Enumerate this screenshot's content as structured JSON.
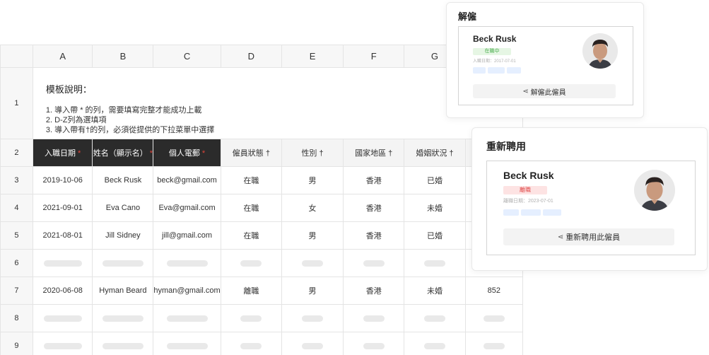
{
  "sheet": {
    "columns": [
      "A",
      "B",
      "C",
      "D",
      "E",
      "F",
      "G"
    ],
    "rows": [
      "1",
      "2",
      "3",
      "4",
      "5",
      "6",
      "7",
      "8",
      "9"
    ],
    "note": {
      "title": "模板說明：",
      "lines": [
        "1. 導入帶 * 的列，需要填寫完整才能成功上載",
        "2. D-Z列為選填項",
        "3. 導入帶有†的列，必須從提供的下拉菜單中選擇"
      ]
    },
    "headers": {
      "join_date": "入職日期",
      "name": "姓名（顯示名）",
      "email": "個人電郵",
      "status": "僱員狀態 †",
      "gender": "性別 †",
      "country": "國家地區 †",
      "marital": "婚姻狀況 †",
      "required_mark": "*"
    },
    "data": [
      {
        "date": "2019-10-06",
        "name": "Beck Rusk",
        "email": "beck@gmail.com",
        "status": "在職",
        "gender": "男",
        "country": "香港",
        "marital": "已婚",
        "extra": ""
      },
      {
        "date": "2021-09-01",
        "name": "Eva Cano",
        "email": "Eva@gmail.com",
        "status": "在職",
        "gender": "女",
        "country": "香港",
        "marital": "未婚",
        "extra": ""
      },
      {
        "date": "2021-08-01",
        "name": "Jill Sidney",
        "email": "jill@gmail.com",
        "status": "在職",
        "gender": "男",
        "country": "香港",
        "marital": "已婚",
        "extra": ""
      },
      {
        "date": "2020-06-08",
        "name": "Hyman Beard",
        "email": "hyman@gmail.com",
        "status": "離職",
        "gender": "男",
        "country": "香港",
        "marital": "未婚",
        "extra": "852"
      }
    ]
  },
  "dismiss_card": {
    "title": "解僱",
    "name": "Beck Rusk",
    "badge": "在職中",
    "sub": "入職日期：2017-07-01",
    "action": "解僱此僱員",
    "badge_color": "#4caf50"
  },
  "rehire_card": {
    "title": "重新聘用",
    "name": "Beck Rusk",
    "badge": "離職",
    "sub": "離職日期：2023-07-01",
    "action": "重新聘用此僱員",
    "badge_color": "#e04848"
  },
  "icons": {
    "action": "link-icon",
    "avatar": "person-avatar"
  }
}
